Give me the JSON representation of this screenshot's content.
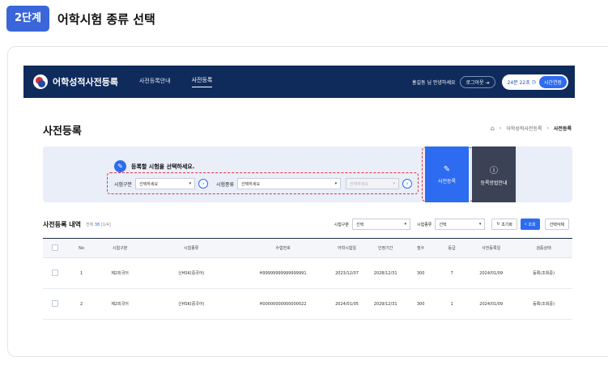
{
  "step": {
    "badge": "2단계",
    "title": "어학시험 종류 선택"
  },
  "app": {
    "logo_text": "어학성적사전등록",
    "nav": [
      "사전등록안내",
      "사전등록"
    ],
    "user_greeting": "홍길동 님 안녕하세요",
    "logout": "로그아웃",
    "timer": "24분 22초",
    "timer_extend": "시간연장"
  },
  "page": {
    "title": "사전등록",
    "breadcrumb": [
      "어학성적사전등록",
      "사전등록"
    ]
  },
  "select_panel": {
    "guide": "등록할 시험을 선택하세요.",
    "field1_label": "시험구분",
    "field1_value": "선택하세요",
    "field2_label": "시험종류",
    "field2_value": "선택하세요",
    "field3_value": "선택하세요",
    "btn_register": "사전등록",
    "btn_guide": "등록방법안내"
  },
  "list": {
    "title": "사전등록 내역",
    "count_prefix": "전체",
    "count_num": "38",
    "count_page": "[1/4]",
    "filter1_label": "시험구분",
    "filter1_value": "선택",
    "filter2_label": "시험종류",
    "filter2_value": "선택",
    "reset": "초기화",
    "search": "조회",
    "delete": "선택삭제",
    "headers": [
      "No",
      "시험구분",
      "시험종류",
      "수험번호",
      "어학시험일",
      "인정기간",
      "점수",
      "등급",
      "사전등록일",
      "검증상태"
    ],
    "rows": [
      [
        "1",
        "제2외국어",
        "신HSK(중국어)",
        "H99999999999999991",
        "2023/12/07",
        "2028/12/31",
        "300",
        "7",
        "2024/01/09",
        "등록(조회중)"
      ],
      [
        "2",
        "제2외국어",
        "신HSK(중국어)",
        "H00000000000000022",
        "2024/01/05",
        "2029/12/31",
        "300",
        "1",
        "2024/01/09",
        "등록(조회중)"
      ]
    ]
  },
  "colors": {
    "nav_bg": "#0f2b5b",
    "accent": "#2d6bf0",
    "highlight": "#e0313c"
  }
}
